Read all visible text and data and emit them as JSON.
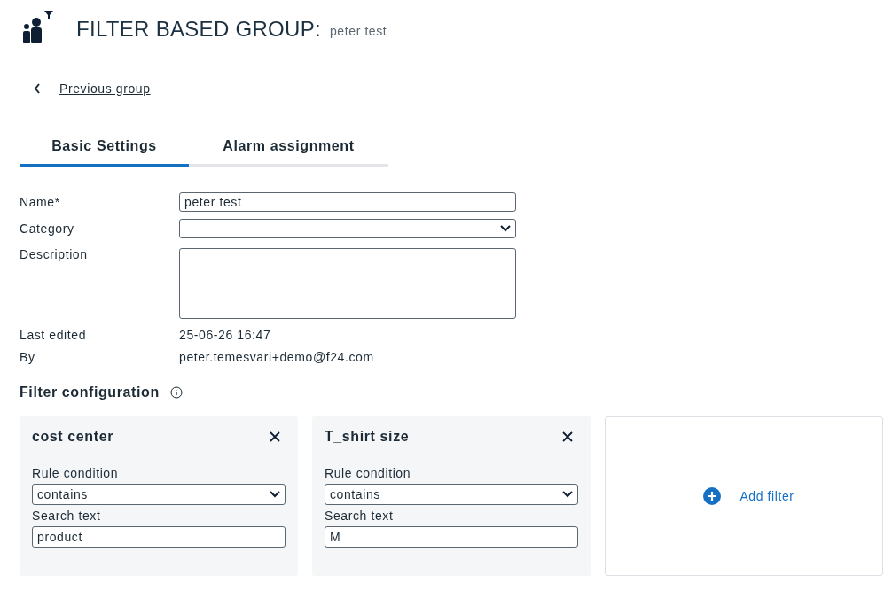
{
  "header": {
    "title": "FILTER BASED GROUP:",
    "subtitle": "peter test"
  },
  "back_link": "Previous group",
  "tabs": [
    {
      "label": "Basic Settings",
      "selected": true
    },
    {
      "label": "Alarm assignment",
      "selected": false
    }
  ],
  "form": {
    "name": {
      "label": "Name*",
      "value": "peter test"
    },
    "category": {
      "label": "Category"
    },
    "description": {
      "label": "Description"
    },
    "last_edited": {
      "label": "Last edited",
      "value": "25-06-26 16:47"
    },
    "by": {
      "label": "By",
      "value": "peter.temesvari+demo@f24.com"
    }
  },
  "filter_configuration": {
    "title": "Filter configuration",
    "filters": [
      {
        "name": "cost center",
        "condition_label": "Rule condition",
        "condition": "contains",
        "search_label": "Search text",
        "search": "product"
      },
      {
        "name": "T_shirt size",
        "condition_label": "Rule condition",
        "condition": "contains",
        "search_label": "Search text",
        "search": "M"
      }
    ],
    "add_label": "Add filter"
  }
}
